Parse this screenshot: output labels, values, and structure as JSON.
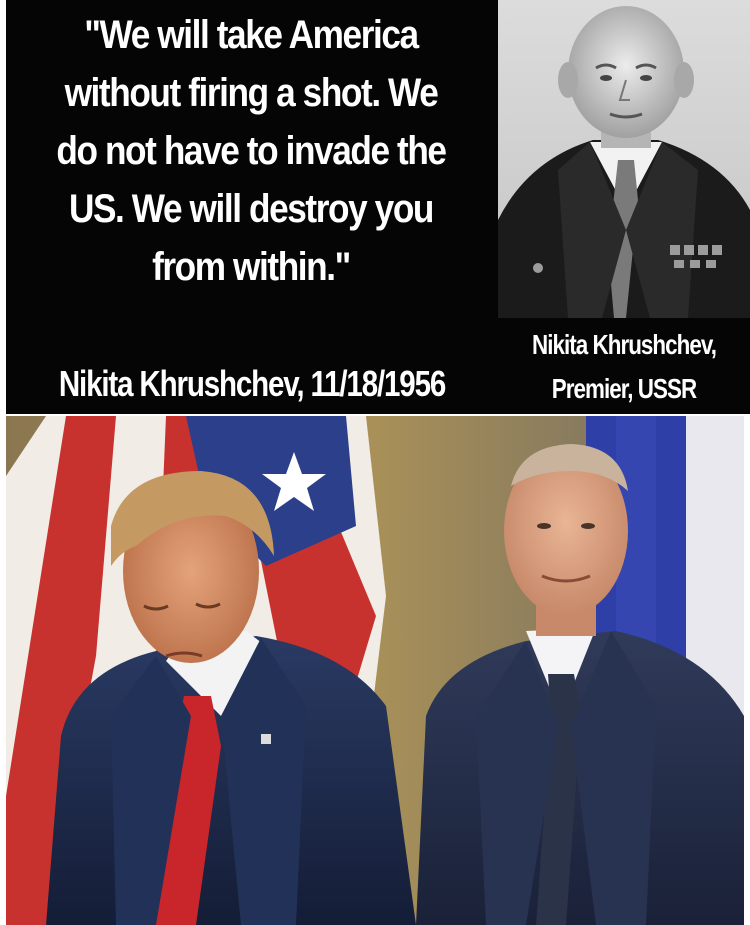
{
  "quote": {
    "lines": [
      "\"We will take America",
      "without firing a shot. We",
      "do not have to invade the",
      "US. We will destroy you",
      "from within.\""
    ],
    "attribution": "Nikita Khrushchev, 11/18/1956"
  },
  "portrait": {
    "caption_name": "Nikita Khrushchev,",
    "caption_title": "Premier, USSR"
  },
  "colors": {
    "panel_background": "#050505",
    "text": "#ffffff",
    "flag_red": "#c8322e",
    "flag_blue": "#2b3f8a",
    "suit_navy": "#1e2a47",
    "tie_red": "#c8262a"
  }
}
